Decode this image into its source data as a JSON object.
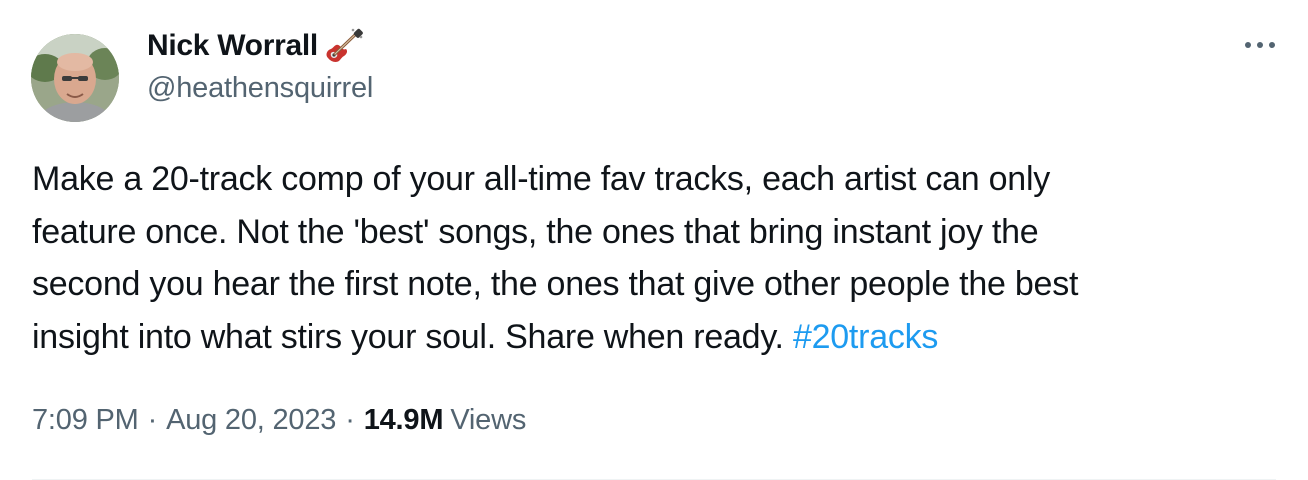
{
  "tweet": {
    "display_name": "Nick Worrall",
    "name_emoji": "guitar-icon",
    "handle": "@heathensquirrel",
    "text_lines": [
      "Make a 20-track comp of your all-time fav tracks, each artist can only",
      "feature once. Not the 'best' songs, the ones that bring instant joy the",
      "second you hear the first note, the ones that give other people the best",
      "insight into what stirs your soul. Share when ready. "
    ],
    "hashtag": "#20tracks",
    "time": "7:09 PM",
    "separator": "·",
    "date": "Aug 20, 2023",
    "views_count": "14.9M",
    "views_label": "Views"
  },
  "colors": {
    "text_primary": "#0f1419",
    "text_secondary": "#536471",
    "link": "#1d9bf0",
    "divider": "#eff3f4"
  }
}
